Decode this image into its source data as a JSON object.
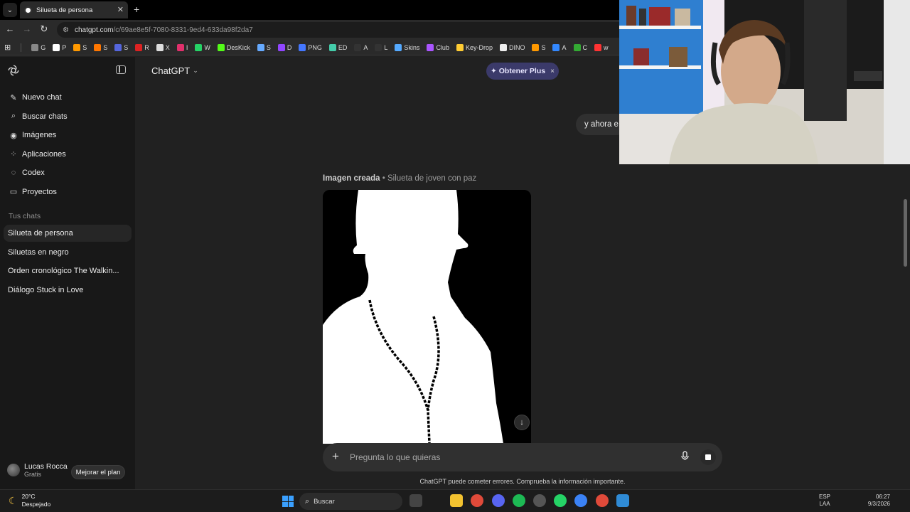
{
  "browser": {
    "tab_title": "Silueta de persona",
    "url_domain": "chatgpt.com",
    "url_path": "/c/69ae8e5f-7080-8331-9ed4-633da98f2da7",
    "bookmarks": [
      {
        "label": "G",
        "color": "#888888"
      },
      {
        "label": "P",
        "color": "#ffffff"
      },
      {
        "label": "S",
        "color": "#ff9900"
      },
      {
        "label": "S",
        "color": "#ff7700"
      },
      {
        "label": "S",
        "color": "#5566dd"
      },
      {
        "label": "R",
        "color": "#dd2222"
      },
      {
        "label": "X",
        "color": "#dddddd"
      },
      {
        "label": "I",
        "color": "#e1306c"
      },
      {
        "label": "W",
        "color": "#25d366"
      },
      {
        "label": "DesKick",
        "color": "#53fc18"
      },
      {
        "label": "S",
        "color": "#66aaff"
      },
      {
        "label": "D",
        "color": "#9146ff"
      },
      {
        "label": "PNG",
        "color": "#4477ff"
      },
      {
        "label": "ED",
        "color": "#44ccaa"
      },
      {
        "label": "A",
        "color": "#333333"
      },
      {
        "label": "L",
        "color": "#333333"
      },
      {
        "label": "Skins",
        "color": "#55aaff"
      },
      {
        "label": "Club",
        "color": "#aa55ff"
      },
      {
        "label": "Key-Drop",
        "color": "#ffcc33"
      },
      {
        "label": "DINO",
        "color": "#eeeeee"
      },
      {
        "label": "S",
        "color": "#ff9900"
      },
      {
        "label": "A",
        "color": "#3388ff"
      },
      {
        "label": "C",
        "color": "#33aa33"
      },
      {
        "label": "w",
        "color": "#ff3333"
      }
    ]
  },
  "sidebar": {
    "toggle_icon": "sidebar-toggle-icon",
    "nav": [
      {
        "label": "Nuevo chat",
        "icon": "✎"
      },
      {
        "label": "Buscar chats",
        "icon": "⌕"
      },
      {
        "label": "Imágenes",
        "icon": "◉"
      },
      {
        "label": "Aplicaciones",
        "icon": "⁘"
      },
      {
        "label": "Codex",
        "icon": "◌"
      },
      {
        "label": "Proyectos",
        "icon": "▭"
      }
    ],
    "section_title": "Tus chats",
    "chats": [
      {
        "label": "Silueta de persona",
        "active": true
      },
      {
        "label": "Siluetas en negro",
        "active": false
      },
      {
        "label": "Orden cronológico The Walkin...",
        "active": false
      },
      {
        "label": "Diálogo Stuck in Love",
        "active": false
      }
    ],
    "user": {
      "name": "Lucas Rocca",
      "plan": "Gratis"
    },
    "upgrade_label": "Mejorar el plan"
  },
  "main": {
    "model_label": "ChatGPT",
    "plus_pill": "✦ Obtener Plus",
    "plus_close": "×",
    "user_message": "y ahora e",
    "image_caption_bold": "Imagen creada",
    "image_caption_detail": " • Silueta de joven con paz",
    "composer_placeholder": "Pregunta lo que quieras",
    "disclaimer": "ChatGPT puede cometer errores. Comprueba la información importante."
  },
  "taskbar": {
    "temperature": "20°C",
    "weather": "Despejado",
    "search_label": "Buscar",
    "lang": "ESP",
    "lang_sub": "LAA",
    "time": "06:27",
    "date": "9/3/2026"
  },
  "colors": {
    "accent_plus": "#3b3a6a",
    "background": "#212121",
    "sidebar": "#181818"
  }
}
